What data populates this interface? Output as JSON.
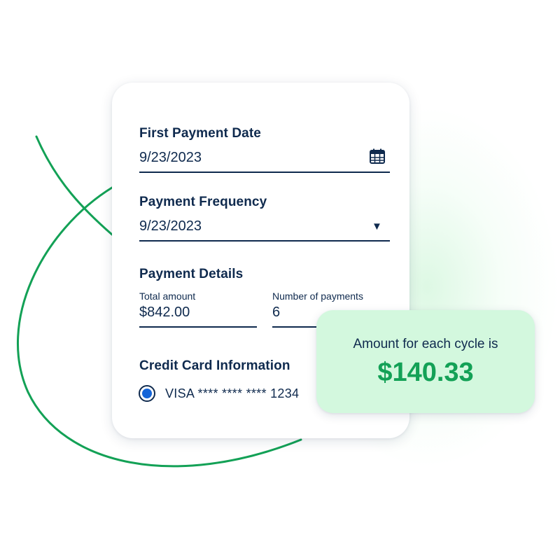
{
  "first_payment": {
    "label": "First Payment Date",
    "value": "9/23/2023",
    "icon": "calendar-icon"
  },
  "frequency": {
    "label": "Payment Frequency",
    "value": "9/23/2023",
    "icon": "caret-down-icon"
  },
  "details": {
    "label": "Payment Details",
    "total_label": "Total amount",
    "total_value": "$842.00",
    "count_label": "Number of payments",
    "count_value": "6"
  },
  "credit_card": {
    "label": "Credit Card Information",
    "card_text": "VISA **** **** **** 1234"
  },
  "result": {
    "caption": "Amount for each cycle is",
    "amount": "$140.33"
  },
  "colors": {
    "navy": "#0f2a4e",
    "green": "#13a156",
    "result_bg": "#d3f8de",
    "radio": "#1565d8"
  }
}
